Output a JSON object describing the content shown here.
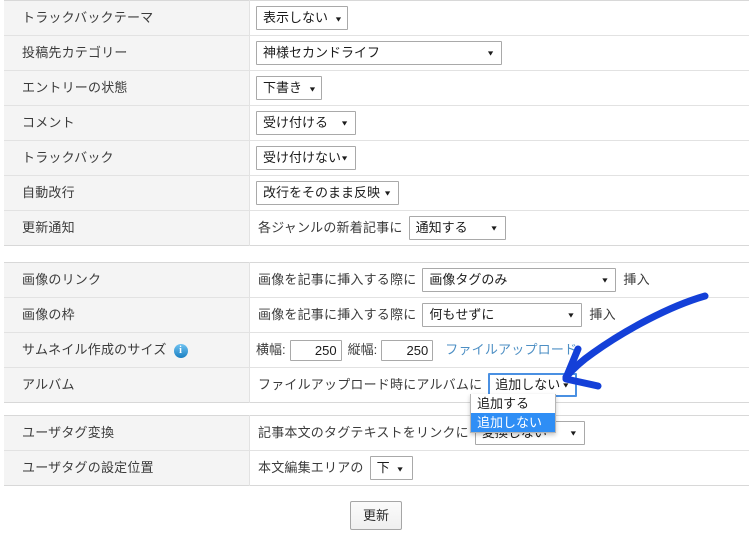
{
  "sections": [
    {
      "id": "blog-post-settings",
      "rows": [
        {
          "label": "トラックバックテーマ",
          "type": "select",
          "value": "表示しない"
        },
        {
          "label": "投稿先カテゴリー",
          "type": "select-wide",
          "value": "神様セカンドライフ"
        },
        {
          "label": "エントリーの状態",
          "type": "select",
          "value": "下書き"
        },
        {
          "label": "コメント",
          "type": "select",
          "value": "受け付ける"
        },
        {
          "label": "トラックバック",
          "type": "select",
          "value": "受け付けない"
        },
        {
          "label": "自動改行",
          "type": "select",
          "value": "改行をそのまま反映"
        },
        {
          "label": "更新通知",
          "type": "prefix-select",
          "prefix": "各ジャンルの新着記事に",
          "value": "通知する"
        }
      ]
    },
    {
      "id": "image-settings",
      "rows": [
        {
          "label": "画像のリンク",
          "type": "prefix-select-suffix",
          "prefix": "画像を記事に挿入する際に",
          "value": "画像タグのみ",
          "suffix": "挿入"
        },
        {
          "label": "画像の枠",
          "type": "prefix-select-suffix",
          "prefix": "画像を記事に挿入する際に",
          "value": "何もせずに",
          "suffix": "挿入"
        },
        {
          "label": "サムネイル作成のサイズ",
          "info_icon": "i",
          "type": "thumbnail-size",
          "width_label": "横幅:",
          "width_value": "250",
          "height_label": "縦幅:",
          "height_value": "250",
          "link": "ファイルアップロード"
        },
        {
          "label": "アルバム",
          "type": "prefix-select-open",
          "prefix": "ファイルアップロード時にアルバムに",
          "value": "追加しない",
          "options": [
            "追加する",
            "追加しない"
          ],
          "selected_option": "追加しない"
        }
      ]
    },
    {
      "id": "usertag-settings",
      "rows": [
        {
          "label": "ユーザタグ変換",
          "type": "prefix-select",
          "prefix": "記事本文のタグテキストをリンクに",
          "value": "変換しない"
        },
        {
          "label": "ユーザタグの設定位置",
          "type": "prefix-select",
          "prefix": "本文編集エリアの",
          "value": "下"
        }
      ]
    }
  ],
  "footer": {
    "update_button": "更新"
  },
  "annotation": {
    "type": "hand-drawn-arrow",
    "color": "#1440d8",
    "points_to": "album-select"
  },
  "colors": {
    "label_background": "#f4f4f4",
    "border": "#e2e2e2",
    "link": "#4d8fc4",
    "highlight": "#2f8ef5",
    "focus_border": "#4a90e2",
    "annotation": "#1440d8"
  }
}
